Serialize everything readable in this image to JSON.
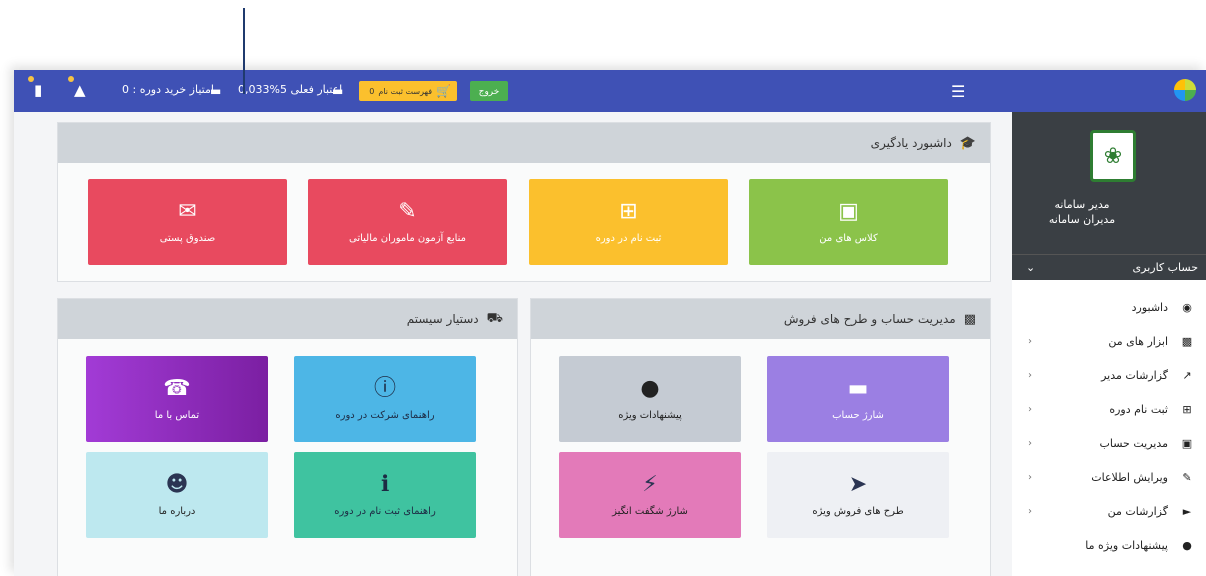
{
  "navbar": {
    "purchase_points": "امتیاز خرید دوره : 0",
    "current_credit": "اعتبار فعلی  5%0,033",
    "cart_label": "فهرست ثبت نام",
    "cart_count": "0",
    "logout_label": "خروج",
    "accent_color": "#3f51b5"
  },
  "panels": {
    "learning": {
      "title": "داشبورد یادگیری",
      "tiles": [
        {
          "label": "کلاس های من",
          "icon": "book-icon",
          "color": "#8bc34a"
        },
        {
          "label": "ثبت نام در دوره",
          "icon": "plus-square-icon",
          "color": "#fbc02d"
        },
        {
          "label": "منابع آزمون ماموران مالیاتی",
          "icon": "edit-icon",
          "color": "#e84a5f"
        },
        {
          "label": "صندوق پستی",
          "icon": "envelope-icon",
          "color": "#e84a5f"
        }
      ]
    },
    "account": {
      "title": "مدیریت حساب و طرح های فروش",
      "tiles": [
        {
          "label": "شارژ حساب",
          "icon": "credit-card-icon",
          "color": "#9b7fe3"
        },
        {
          "label": "پیشنهادات ویژه",
          "icon": "bomb-icon",
          "color": "#c5cbd3"
        },
        {
          "label": "طرح های فروش ویژه",
          "icon": "paper-plane-icon",
          "color": "#eef0f4"
        },
        {
          "label": "شارژ شگفت انگیز",
          "icon": "bolt-icon",
          "color": "#e37ab9"
        }
      ]
    },
    "assistant": {
      "title": "دستیار سیستم",
      "tiles": [
        {
          "label": "راهنمای شرکت در دوره",
          "icon": "info-circle-icon",
          "color": "#4db6e6"
        },
        {
          "label": "تماس با ما",
          "icon": "phone-icon",
          "color": "#a23bd6"
        },
        {
          "label": "راهنمای ثبت نام در دوره",
          "icon": "info-icon",
          "color": "#3fc3a0"
        },
        {
          "label": "درباره ما",
          "icon": "users-icon",
          "color": "#bde8ef"
        }
      ]
    }
  },
  "sidebar": {
    "user_name": "مدیر سامانه",
    "user_role": "مدیران سامانه",
    "account_label": "حساب کاربری",
    "items": [
      {
        "label": "داشبورد",
        "icon": "dashboard-icon",
        "has_submenu": false
      },
      {
        "label": "ابزار های من",
        "icon": "briefcase-icon",
        "has_submenu": true
      },
      {
        "label": "گزارشات مدیر",
        "icon": "chart-line-icon",
        "has_submenu": true
      },
      {
        "label": "ثبت نام دوره",
        "icon": "plus-square-icon",
        "has_submenu": true
      },
      {
        "label": "مدیریت حساب",
        "icon": "money-icon",
        "has_submenu": true
      },
      {
        "label": "ویرایش اطلاعات",
        "icon": "edit-icon",
        "has_submenu": true
      },
      {
        "label": "گزارشات من",
        "icon": "bullhorn-icon",
        "has_submenu": true
      },
      {
        "label": "پیشنهادات ویژه ما",
        "icon": "bomb-icon",
        "has_submenu": false
      }
    ]
  }
}
